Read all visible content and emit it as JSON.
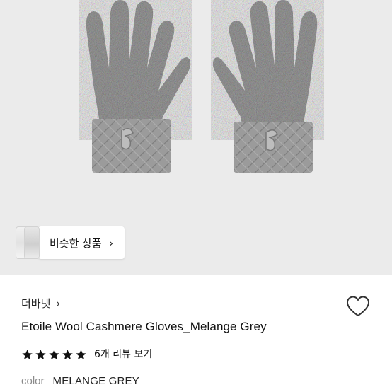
{
  "hero": {
    "similar_button_label": "비슷한 상품",
    "colors": {
      "background": "#ebebeb",
      "knit": "#9a9a9a"
    }
  },
  "product": {
    "brand": "더바넷",
    "title": "Etoile Wool Cashmere Gloves_Melange Grey",
    "rating": 5,
    "rating_max": 5,
    "review_link": "6개 리뷰 보기",
    "color_label": "color",
    "color_value": "MELANGE GREY"
  },
  "icons": {
    "brand_chevron": "chevron-right-icon",
    "wishlist": "heart-outline-icon",
    "star": "star-filled-icon"
  }
}
